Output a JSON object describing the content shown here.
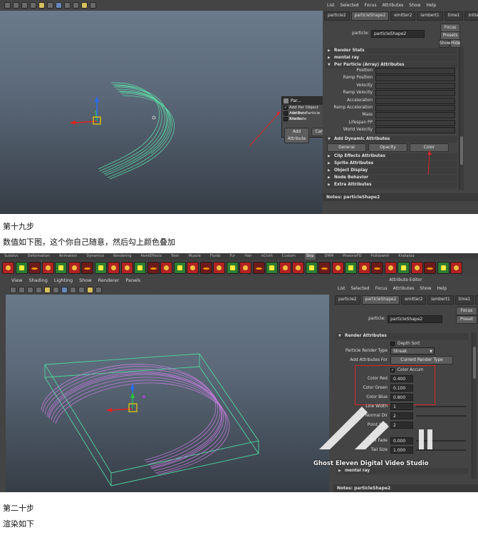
{
  "screen1": {
    "ae_menu": [
      "List",
      "Selected",
      "Focus",
      "Attributes",
      "Show",
      "Help"
    ],
    "tabs": [
      "particle2",
      "particleShape2",
      "emitter2",
      "lambert1",
      "time1",
      "initialPa"
    ],
    "particle_label": "particle:",
    "particle_value": "particleShape2",
    "buttons": {
      "focus": "Focus",
      "presets": "Presets",
      "show": "Show",
      "hide": "Hide"
    },
    "sections_top": [
      "Render Stats",
      "mental ray",
      "Per Particle (Array) Attributes"
    ],
    "per_particle_attrs": [
      "Position",
      "Ramp Position",
      "Velocity",
      "Ramp Velocity",
      "Acceleration",
      "Ramp Acceleration",
      "Mass",
      "Lifespan PP",
      "World Velocity"
    ],
    "add_dynamic": "Add Dynamic Attributes",
    "dyn_buttons": {
      "general": "General",
      "opacity": "Opacity",
      "color": "Color"
    },
    "sections_bottom": [
      "Clip Effects Attributes",
      "Sprite Attributes",
      "Object Display",
      "Node Behavior",
      "Extra Attributes"
    ],
    "notes": "Notes: particleShape2",
    "dialog": {
      "title": "Par...",
      "options": [
        {
          "label": "Add Per Object Attribute",
          "checked": true
        },
        {
          "label": "Add Per Particle Attribute",
          "checked": false
        },
        {
          "label": "Shader",
          "checked": false
        }
      ],
      "add_button": "Add Attribute",
      "cancel_button": "Cancel"
    }
  },
  "caption_step19": "第十九步",
  "caption_values": "数值如下图，这个你自己随意，然后勾上颜色叠加",
  "screen2": {
    "shelf_tabs": [
      "Subdivs",
      "Deformation",
      "Animation",
      "Dynamics",
      "Rendering",
      "PaintEffects",
      "Toon",
      "Muscle",
      "Fluids",
      "Fur",
      "Hair",
      "nCloth",
      "Custom",
      "Skip",
      "DMM",
      "PhoenixFD",
      "Pulldownit",
      "Krakatoa"
    ],
    "shelf_active": "Skip",
    "view_menu": [
      "View",
      "Shading",
      "Lighting",
      "Show",
      "Renderer",
      "Panels"
    ],
    "ae_title": "Attribute Editor",
    "ae_menu": [
      "List",
      "Selected",
      "Focus",
      "Attributes",
      "Show",
      "Help"
    ],
    "tabs": [
      "particle2",
      "particleShape2",
      "emitter2",
      "lambert1",
      "time1",
      "initialPa"
    ],
    "particle_label": "particle:",
    "particle_value": "particleShape2",
    "buttons": {
      "focus": "Focus",
      "presets": "Preset"
    },
    "render_section": "Render Attributes",
    "depth_sort": "Depth Sort",
    "render_type_label": "Particle Render Type",
    "render_type_value": "Streak",
    "add_attrs_label": "Add Attributes For",
    "current_render_type": "Current Render Type",
    "color_accum": "Color Accum",
    "color_red_label": "Color Red",
    "color_red": "0.400",
    "color_green_label": "Color Green",
    "color_green": "0.100",
    "color_blue_label": "Color Blue",
    "color_blue": "0.800",
    "line_width_label": "Line Width",
    "line_width": "1",
    "normal_dir_label": "Normal Dir",
    "normal_dir": "2",
    "point_size_label": "Point Size",
    "point_size": "2",
    "tail_fade_label": "Tail Fade",
    "tail_fade": "0.000",
    "tail_size_label": "Tail Size",
    "tail_size": "1.000",
    "mental_ray": "mental ray",
    "notes": "Notes: particleShape2",
    "watermark": "Ghost Eleven Digital Video Studio"
  },
  "caption_step20": "第二十步",
  "caption_render": "渲染如下",
  "colors": {
    "particles_green": "#5fe0a8",
    "particles_purple": "#c77ee0",
    "highlight_red": "#d62828"
  }
}
